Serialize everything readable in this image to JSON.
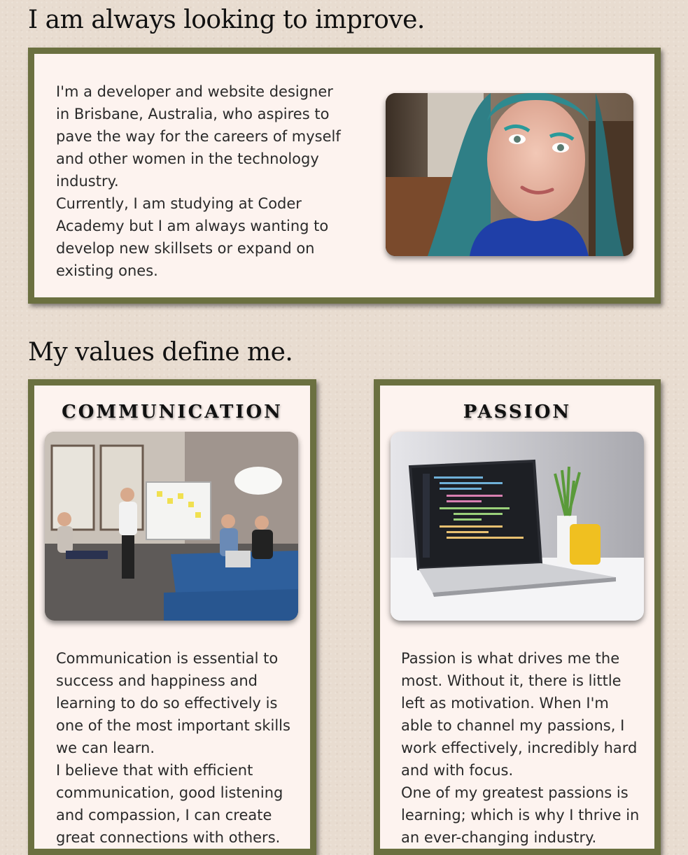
{
  "about": {
    "heading": "I am always looking to improve.",
    "paragraph_1": "I'm a developer and website designer in Brisbane, Australia, who aspires to pave the way for the careers of myself and other women in the technology industry.",
    "paragraph_2": "Currently, I am studying at Coder Academy but I am always wanting to develop new skillsets or expand on existing ones."
  },
  "values": {
    "heading": "My values define me.",
    "cards": [
      {
        "title": "COMMUNICATION",
        "paragraph_1": "Communication is essential to success and happiness and learning to do so effectively is one of the most important skills we can learn.",
        "paragraph_2": "I believe that with efficient communication, good listening and compassion, I can create great connections with others."
      },
      {
        "title": "PASSION",
        "paragraph_1": "Passion is what drives me the most. Without it, there is little left as motivation. When I'm able to channel my passions, I work effectively, incredibly hard and with focus.",
        "paragraph_2": "One of my greatest passions is learning; which is why I thrive in an ever-changing industry."
      }
    ]
  },
  "colors": {
    "panel_border": "#6b7040",
    "panel_background": "#fdf3ef",
    "page_background": "#e8dcd0"
  }
}
